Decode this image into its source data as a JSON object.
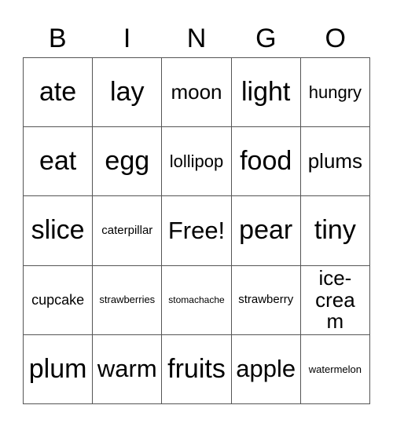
{
  "header": {
    "letters": [
      "B",
      "I",
      "N",
      "G",
      "O"
    ]
  },
  "board": {
    "rows": [
      [
        "ate",
        "lay",
        "moon",
        "light",
        "hungry"
      ],
      [
        "eat",
        "egg",
        "lollipop",
        "food",
        "plums"
      ],
      [
        "slice",
        "caterpillar",
        "Free!",
        "pear",
        "tiny"
      ],
      [
        "cupcake",
        "strawberries",
        "stomachache",
        "strawberry",
        "ice-cream"
      ],
      [
        "plum",
        "warm",
        "fruits",
        "apple",
        "watermelon"
      ]
    ],
    "free_space": "Free!"
  }
}
